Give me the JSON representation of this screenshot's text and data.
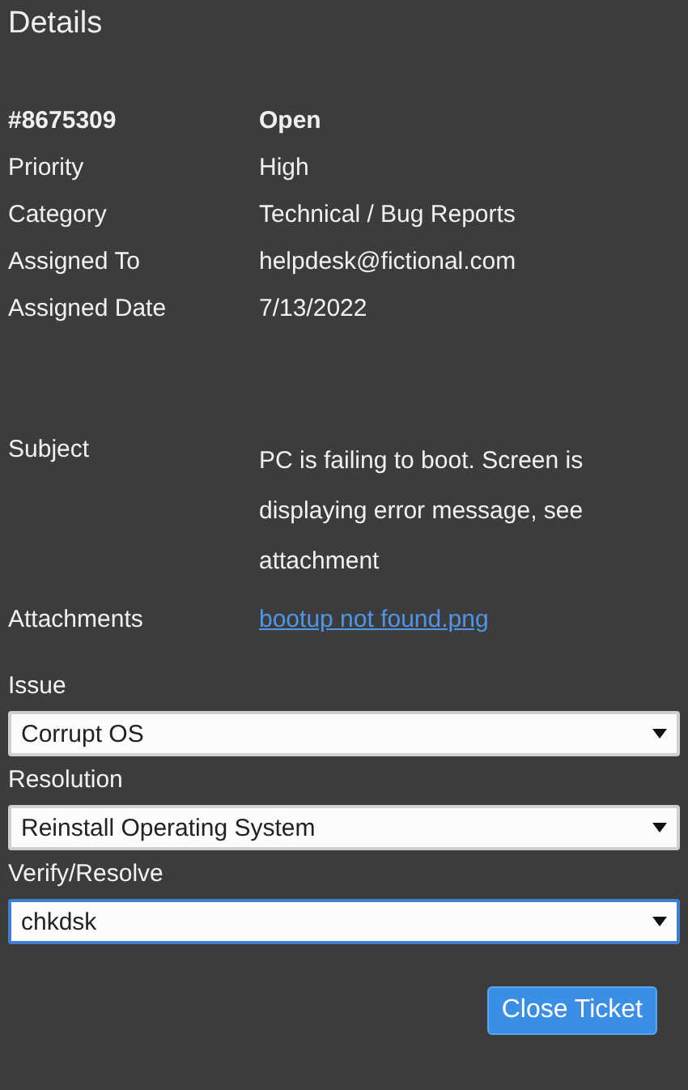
{
  "title": "Details",
  "ticket": {
    "number": "#8675309",
    "status": "Open"
  },
  "fields": [
    {
      "label": "Priority",
      "value": "High"
    },
    {
      "label": "Category",
      "value": "Technical / Bug Reports"
    },
    {
      "label": "Assigned To",
      "value": "helpdesk@fictional.com"
    },
    {
      "label": "Assigned Date",
      "value": "7/13/2022"
    }
  ],
  "subject": {
    "label": "Subject",
    "value": "PC is failing to boot. Screen is displaying error message, see attachment"
  },
  "attachments": {
    "label": "Attachments",
    "link": "bootup not found.png"
  },
  "selects": [
    {
      "label": "Issue",
      "value": "Corrupt OS",
      "focused": false
    },
    {
      "label": "Resolution",
      "value": "Reinstall Operating System",
      "focused": false
    },
    {
      "label": "Verify/Resolve",
      "value": "chkdsk",
      "focused": true
    }
  ],
  "button": "Close Ticket"
}
